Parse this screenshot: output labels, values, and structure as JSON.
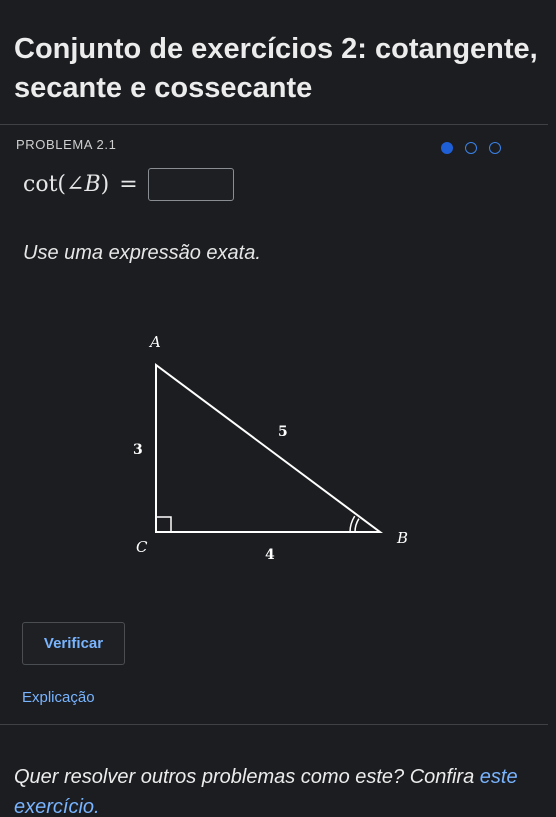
{
  "header": {
    "title": "Conjunto de exercícios 2: cotangente, secante e cossecante"
  },
  "problem": {
    "label": "PROBLEMA 2.1",
    "progress": {
      "total": 3,
      "current": 1
    },
    "equation": {
      "func": "cot",
      "open": "(",
      "angle_symbol": "∠",
      "var": "B",
      "close": ")",
      "equals": "="
    },
    "answer_value": "",
    "instruction": "Use uma expressão exata."
  },
  "figure": {
    "vertices": {
      "A": "A",
      "B": "B",
      "C": "C"
    },
    "sides": {
      "AC": "3",
      "AB": "5",
      "CB": "4"
    }
  },
  "actions": {
    "verify_label": "Verificar",
    "explanation_label": "Explicação"
  },
  "footer": {
    "text": "Quer resolver outros problemas como este? Confira",
    "link": "este exercício."
  },
  "colors": {
    "background": "#1b1d20",
    "accent": "#79b4ff",
    "progress_active": "#1f5fd6"
  }
}
